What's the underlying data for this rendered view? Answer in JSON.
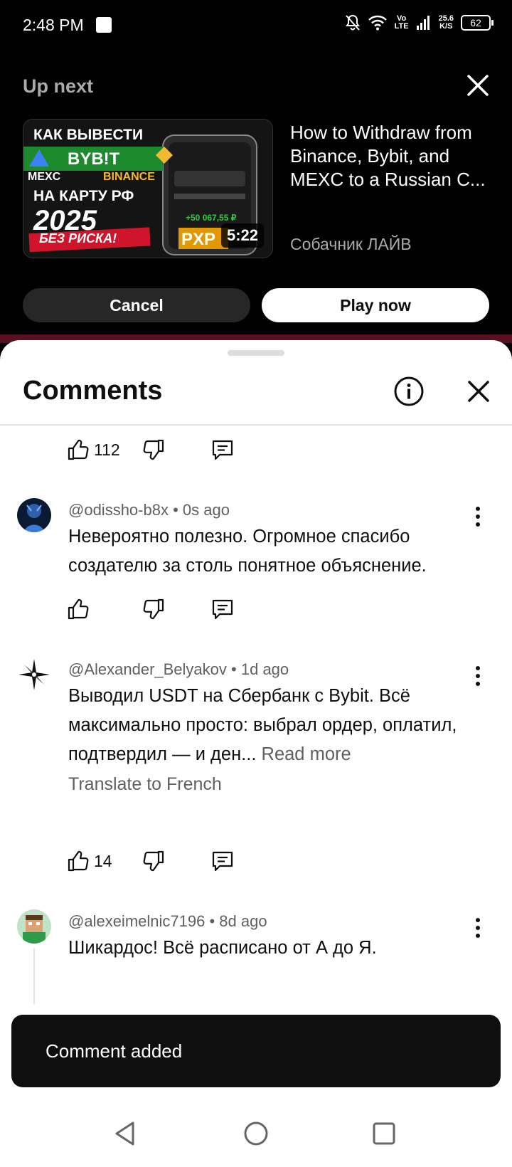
{
  "status_bar": {
    "time": "2:48 PM",
    "network_speed_value": "25.6",
    "network_speed_unit": "K/S",
    "volte_top": "Vo",
    "volte_bottom": "LTE",
    "battery": "62"
  },
  "up_next": {
    "label": "Up next",
    "video_title": "How to Withdraw from Binance, Bybit, and MEXC to a Russian C...",
    "channel": "Собачник ЛАЙВ",
    "duration": "5:22",
    "thumbnail_text": {
      "line1": "КАК ВЫВЕСТИ",
      "bybit": "BYB!T",
      "mexc": "MEXC",
      "binance": "BINANCE",
      "line3": "НА КАРТУ РФ",
      "year": "2025",
      "badge": "БЕЗ РИСКА!"
    },
    "cancel_label": "Cancel",
    "play_label": "Play now"
  },
  "comments_panel": {
    "title": "Comments",
    "top_actions": {
      "likes": "112"
    },
    "comments": [
      {
        "author": "@odissho-b8x",
        "time": "0s ago",
        "text": "Невероятно полезно. Огромное спасибо создателю за столь понятное объяснение.",
        "likes": ""
      },
      {
        "author": "@Alexander_Belyakov",
        "time": "1d ago",
        "text": "Выводил USDT на Сбербанк с Bybit. Всё максимально просто: выбрал ордер, оплатил, подтвердил — и ден...",
        "read_more": "Read more",
        "translate": "Translate to French",
        "likes": "14"
      },
      {
        "author": "@alexeimelnic7196",
        "time": "8d ago",
        "text": "Шикардос! Всё расписано от А до Я.",
        "likes": ""
      }
    ]
  },
  "toast": {
    "message": "Comment added"
  },
  "colors": {
    "bybit_yellow": "#f7a600",
    "binance_yellow": "#f3ba2f",
    "thumb_green": "#1e8a2e",
    "badge_red": "#d0142c"
  }
}
